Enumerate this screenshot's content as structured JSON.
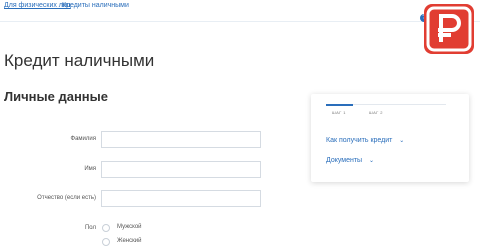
{
  "topnav": {
    "link1": "Для физических лиц",
    "link2": "Кредиты наличными"
  },
  "page": {
    "title": "Кредит наличными",
    "section_title": "Личные данные"
  },
  "form": {
    "lastname_label": "Фамилия",
    "firstname_label": "Имя",
    "patronymic_label": "Отчество (если есть)",
    "gender_label": "Пол",
    "gender_options": [
      "Мужской",
      "Женский"
    ]
  },
  "side": {
    "step1": "ШАГ 1",
    "step2": "ШАГ 2",
    "how_to_get": "Как получить кредит",
    "documents": "Документы"
  },
  "colors": {
    "accent": "#2a6ebb",
    "badge": "#e13d32"
  }
}
